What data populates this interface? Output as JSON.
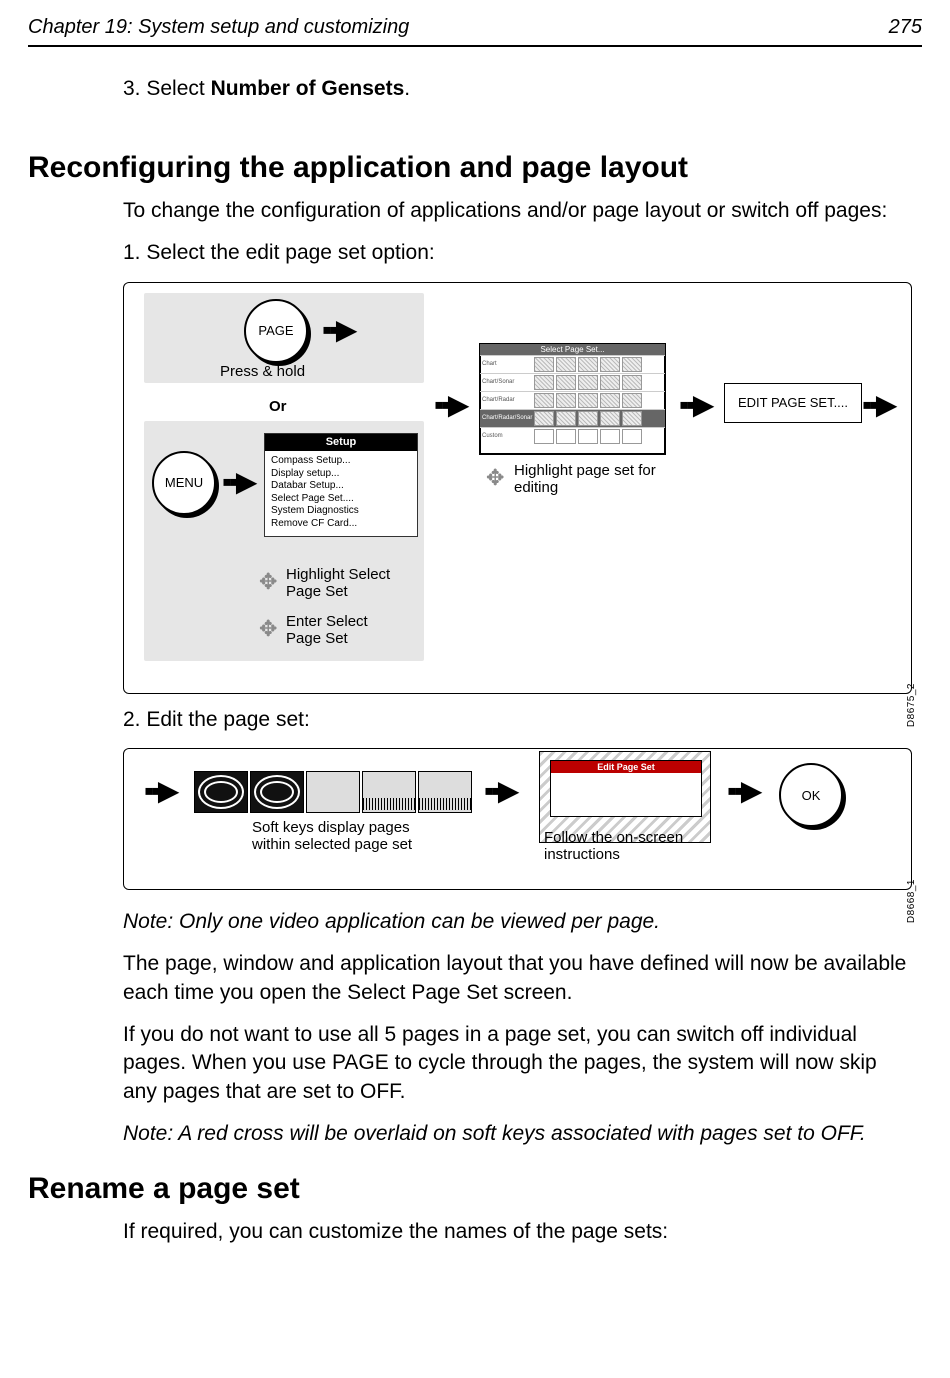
{
  "header": {
    "chapter": "Chapter 19: System setup and customizing",
    "page_number": "275"
  },
  "steps_top": {
    "s3_prefix": "3.   Select ",
    "s3_bold": "Number of Gensets",
    "s3_suffix": "."
  },
  "section1": {
    "title": "Reconfiguring the application and page layout",
    "intro": "To change the configuration of applications and/or page layout or switch off pages:",
    "step1": "1. Select the edit page set option:",
    "step2": "2. Edit the page set:",
    "note1": "Note: Only one video application can be viewed per page.",
    "para1": "The page, window and application layout that you have defined will now be available each time you open the Select Page Set screen.",
    "para2": "If you do not want to use all 5 pages in a page set, you can switch off individual pages. When you use PAGE to cycle through the pages, the system will now skip any pages that are set to OFF.",
    "note2": "Note: A red cross will be overlaid on soft keys associated with pages set to OFF."
  },
  "section2": {
    "title": "Rename a page set",
    "intro": "If required, you can customize the names of the page sets:"
  },
  "diagram1": {
    "sidecode": "D8675_2",
    "page_btn": "PAGE",
    "menu_btn": "MENU",
    "press_hold": "Press & hold",
    "or": "Or",
    "setup_menu": {
      "title": "Setup",
      "items": [
        "Compass Setup...",
        "Display setup...",
        "Databar Setup...",
        "Select Page Set....",
        "System Diagnostics",
        "Remove CF Card..."
      ]
    },
    "label_highlight_select": "Highlight Select\nPage Set",
    "label_enter_select": "Enter Select\nPage Set",
    "pageset_header": "Select Page Set...",
    "pageset_rows": [
      "Chart",
      "Chart/Sonar",
      "Chart/Radar",
      "Chart/Radar/Sonar",
      "Custom"
    ],
    "label_highlight_edit": "Highlight page set for\nediting",
    "softkey_edit": "EDIT PAGE SET...."
  },
  "diagram2": {
    "sidecode": "D8668_1",
    "caption_softkeys": "Soft keys display pages\nwithin selected page set",
    "eps_title": "Edit Page Set",
    "caption_follow": "Follow the on-screen\ninstructions",
    "ok_btn": "OK"
  }
}
